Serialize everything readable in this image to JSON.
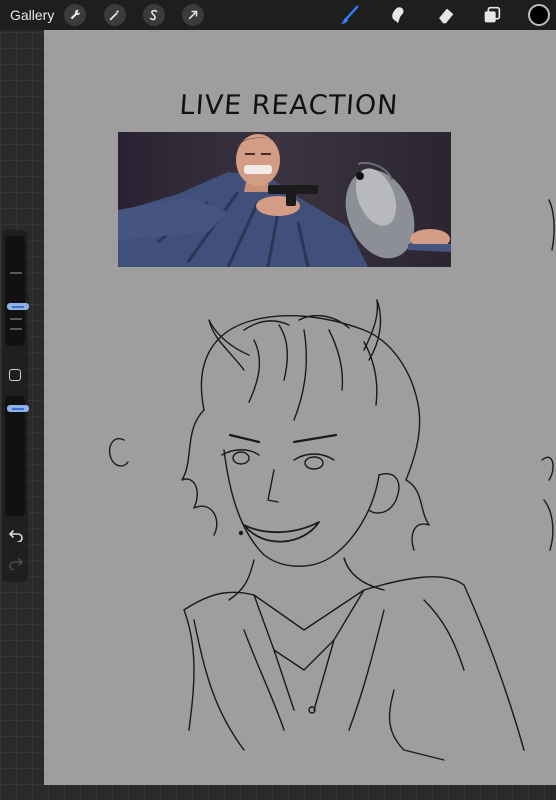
{
  "toolbar": {
    "gallery_label": "Gallery",
    "actions": [
      "wrench-icon",
      "magic-wand-icon",
      "selection-icon",
      "transform-arrow-icon"
    ],
    "tools": [
      "brush-icon",
      "smudge-icon",
      "eraser-icon",
      "layers-icon"
    ],
    "active_tool": "brush-icon",
    "active_color": "#000000",
    "accent_color": "#2f7fff"
  },
  "canvas": {
    "title": "LIVE REACTION",
    "background": "#9e9e9e",
    "photo_description": "man grimacing holding a gun to a fish"
  },
  "sidebar": {
    "brush_size_level": 0.35,
    "opacity_level": 0.05
  }
}
